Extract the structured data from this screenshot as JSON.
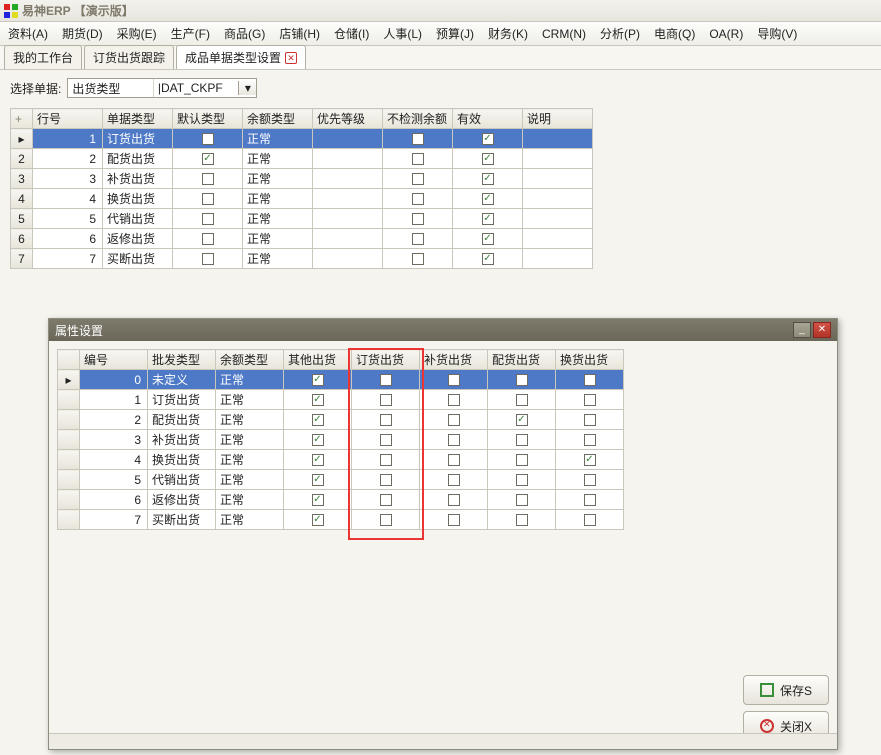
{
  "window": {
    "title": "易神ERP 【演示版】"
  },
  "menu": [
    "资料(A)",
    "期货(D)",
    "采购(E)",
    "生产(F)",
    "商品(G)",
    "店铺(H)",
    "仓储(I)",
    "人事(L)",
    "预算(J)",
    "财务(K)",
    "CRM(N)",
    "分析(P)",
    "电商(Q)",
    "OA(R)",
    "导购(V)"
  ],
  "tabs": [
    {
      "label": "我的工作台",
      "closable": false,
      "active": false
    },
    {
      "label": "订货出货跟踪",
      "closable": false,
      "active": false
    },
    {
      "label": "成品单据类型设置",
      "closable": true,
      "active": true
    }
  ],
  "selector": {
    "label": "选择单据:",
    "value_left": "出货类型",
    "value_right": "|DAT_CKPF"
  },
  "top_grid": {
    "add_sign": "+",
    "cols": [
      "行号",
      "单据类型",
      "默认类型",
      "余额类型",
      "优先等级",
      "不检测余额",
      "有效",
      "说明"
    ],
    "widths": [
      70,
      70,
      70,
      70,
      70,
      70,
      70,
      70
    ],
    "rows": [
      {
        "n": 1,
        "type": "订货出货",
        "def": false,
        "bal": "正常",
        "prio": "",
        "nochk": false,
        "enabled": true,
        "desc": "",
        "sel": true
      },
      {
        "n": 2,
        "type": "配货出货",
        "def": true,
        "bal": "正常",
        "prio": "",
        "nochk": false,
        "enabled": true,
        "desc": "",
        "sel": false
      },
      {
        "n": 3,
        "type": "补货出货",
        "def": false,
        "bal": "正常",
        "prio": "",
        "nochk": false,
        "enabled": true,
        "desc": "",
        "sel": false
      },
      {
        "n": 4,
        "type": "换货出货",
        "def": false,
        "bal": "正常",
        "prio": "",
        "nochk": false,
        "enabled": true,
        "desc": "",
        "sel": false
      },
      {
        "n": 5,
        "type": "代销出货",
        "def": false,
        "bal": "正常",
        "prio": "",
        "nochk": false,
        "enabled": true,
        "desc": "",
        "sel": false
      },
      {
        "n": 6,
        "type": "返修出货",
        "def": false,
        "bal": "正常",
        "prio": "",
        "nochk": false,
        "enabled": true,
        "desc": "",
        "sel": false
      },
      {
        "n": 7,
        "type": "买断出货",
        "def": false,
        "bal": "正常",
        "prio": "",
        "nochk": false,
        "enabled": true,
        "desc": "",
        "sel": false
      }
    ]
  },
  "dialog": {
    "title": "属性设置",
    "cols": [
      "编号",
      "批发类型",
      "余额类型",
      "其他出货",
      "订货出货",
      "补货出货",
      "配货出货",
      "换货出货"
    ],
    "rows": [
      {
        "n": 0,
        "wtype": "未定义",
        "bal": "正常",
        "c3": true,
        "c4": false,
        "c5": false,
        "c6": false,
        "c7": false,
        "sel": true
      },
      {
        "n": 1,
        "wtype": "订货出货",
        "bal": "正常",
        "c3": true,
        "c4": false,
        "c5": false,
        "c6": false,
        "c7": false,
        "sel": false
      },
      {
        "n": 2,
        "wtype": "配货出货",
        "bal": "正常",
        "c3": true,
        "c4": false,
        "c5": false,
        "c6": true,
        "c7": false,
        "sel": false
      },
      {
        "n": 3,
        "wtype": "补货出货",
        "bal": "正常",
        "c3": true,
        "c4": false,
        "c5": false,
        "c6": false,
        "c7": false,
        "sel": false
      },
      {
        "n": 4,
        "wtype": "换货出货",
        "bal": "正常",
        "c3": true,
        "c4": false,
        "c5": false,
        "c6": false,
        "c7": true,
        "sel": false
      },
      {
        "n": 5,
        "wtype": "代销出货",
        "bal": "正常",
        "c3": true,
        "c4": false,
        "c5": false,
        "c6": false,
        "c7": false,
        "sel": false
      },
      {
        "n": 6,
        "wtype": "返修出货",
        "bal": "正常",
        "c3": true,
        "c4": false,
        "c5": false,
        "c6": false,
        "c7": false,
        "sel": false
      },
      {
        "n": 7,
        "wtype": "买断出货",
        "bal": "正常",
        "c3": true,
        "c4": false,
        "c5": false,
        "c6": false,
        "c7": false,
        "sel": false
      }
    ],
    "save_label": "保存S",
    "close_label": "关闭X"
  }
}
